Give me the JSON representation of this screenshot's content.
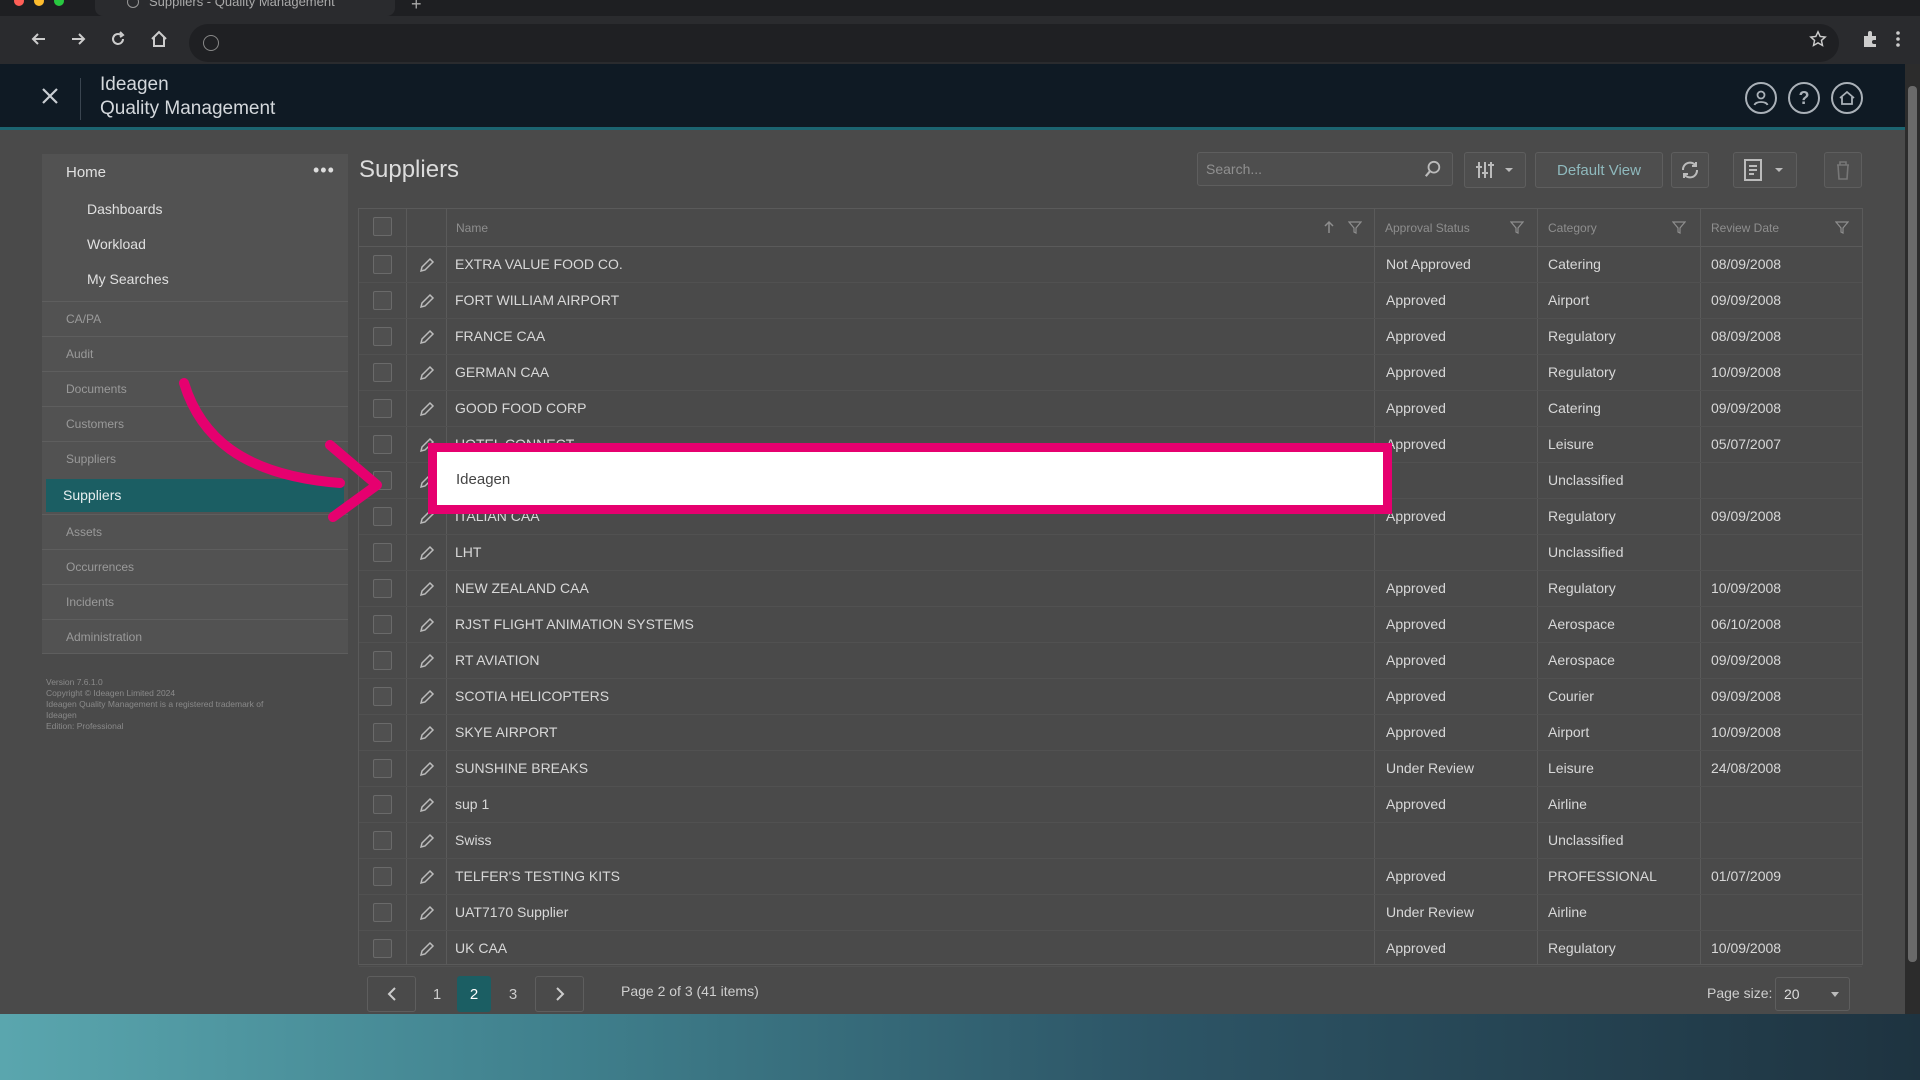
{
  "browser": {
    "tab_title": "Suppliers - Quality Management",
    "new_tab": "+"
  },
  "app": {
    "brand_line1": "Ideagen",
    "brand_line2": "Quality Management"
  },
  "sidebar": {
    "home": "Home",
    "more": "•••",
    "subitems": [
      "Dashboards",
      "Workload",
      "My Searches"
    ],
    "sections": [
      "CA/PA",
      "Audit",
      "Documents",
      "Customers",
      "Suppliers"
    ],
    "active": "Suppliers",
    "sections_after": [
      "Assets",
      "Occurrences",
      "Incidents",
      "Administration"
    ],
    "footer": [
      "Version 7.6.1.0",
      "Copyright © Ideagen Limited 2024",
      "Ideagen Quality Management is a registered trademark of",
      "Ideagen",
      "Edition: Professional"
    ]
  },
  "page": {
    "title": "Suppliers",
    "search_placeholder": "Search...",
    "default_view": "Default View"
  },
  "table": {
    "columns": [
      "Name",
      "Approval Status",
      "Category",
      "Review Date"
    ],
    "rows": [
      {
        "name": "EXTRA VALUE FOOD CO.",
        "status": "Not Approved",
        "category": "Catering",
        "date": "08/09/2008"
      },
      {
        "name": "FORT WILLIAM AIRPORT",
        "status": "Approved",
        "category": "Airport",
        "date": "09/09/2008"
      },
      {
        "name": "FRANCE CAA",
        "status": "Approved",
        "category": "Regulatory",
        "date": "08/09/2008"
      },
      {
        "name": "GERMAN CAA",
        "status": "Approved",
        "category": "Regulatory",
        "date": "10/09/2008"
      },
      {
        "name": "GOOD FOOD CORP",
        "status": "Approved",
        "category": "Catering",
        "date": "09/09/2008"
      },
      {
        "name": "HOTEL CONNECT",
        "status": "Approved",
        "category": "Leisure",
        "date": "05/07/2007"
      },
      {
        "name": "",
        "status": "",
        "category": "Unclassified",
        "date": ""
      },
      {
        "name": "ITALIAN CAA",
        "status": "Approved",
        "category": "Regulatory",
        "date": "09/09/2008"
      },
      {
        "name": "LHT",
        "status": "",
        "category": "Unclassified",
        "date": ""
      },
      {
        "name": "NEW ZEALAND CAA",
        "status": "Approved",
        "category": "Regulatory",
        "date": "10/09/2008"
      },
      {
        "name": "RJST FLIGHT ANIMATION SYSTEMS",
        "status": "Approved",
        "category": "Aerospace",
        "date": "06/10/2008"
      },
      {
        "name": "RT AVIATION",
        "status": "Approved",
        "category": "Aerospace",
        "date": "09/09/2008"
      },
      {
        "name": "SCOTIA HELICOPTERS",
        "status": "Approved",
        "category": "Courier",
        "date": "09/09/2008"
      },
      {
        "name": "SKYE AIRPORT",
        "status": "Approved",
        "category": "Airport",
        "date": "10/09/2008"
      },
      {
        "name": "SUNSHINE BREAKS",
        "status": "Under Review",
        "category": "Leisure",
        "date": "24/08/2008"
      },
      {
        "name": "sup 1",
        "status": "Approved",
        "category": "Airline",
        "date": ""
      },
      {
        "name": "Swiss",
        "status": "",
        "category": "Unclassified",
        "date": ""
      },
      {
        "name": "TELFER'S TESTING KITS",
        "status": "Approved",
        "category": "PROFESSIONAL",
        "date": "01/07/2009"
      },
      {
        "name": "UAT7170 Supplier",
        "status": "Under Review",
        "category": "Airline",
        "date": ""
      },
      {
        "name": "UK CAA",
        "status": "Approved",
        "category": "Regulatory",
        "date": "10/09/2008"
      }
    ],
    "highlight_text": "Ideagen"
  },
  "pager": {
    "pages": [
      "1",
      "2",
      "3"
    ],
    "current": "2",
    "info": "Page 2 of 3 (41 items)",
    "size_label": "Page size:",
    "size_value": "20"
  },
  "colors": {
    "accent": "#1b5e63",
    "highlight": "#e6006f"
  }
}
